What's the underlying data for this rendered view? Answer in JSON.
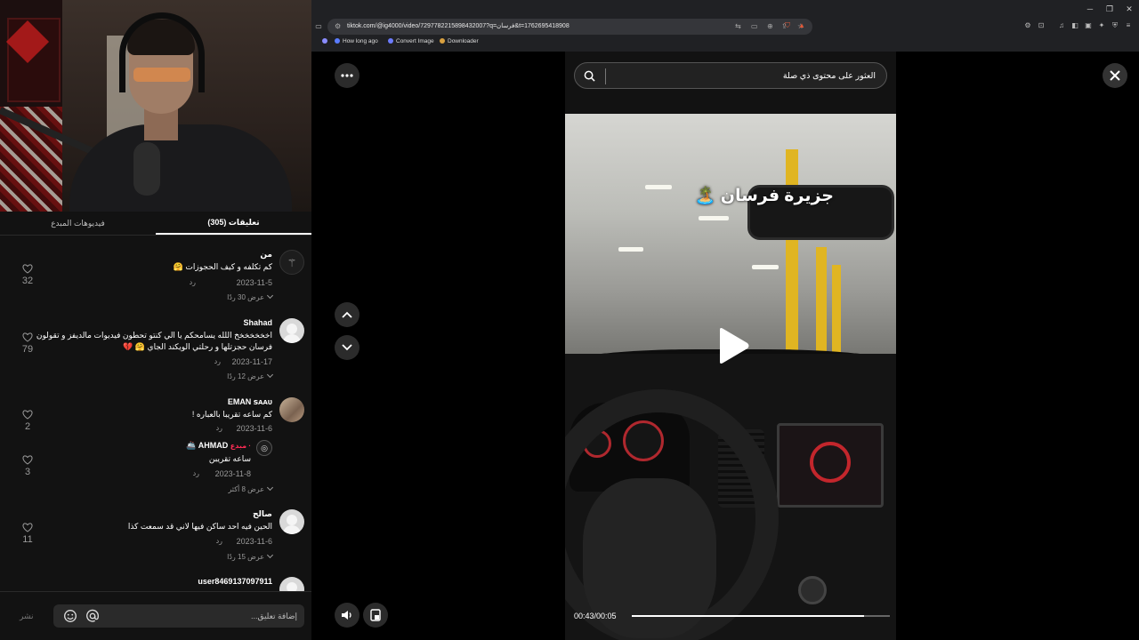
{
  "browser": {
    "url": "tiktok.com/@ig4000/video/7297782215898432007?q=فرسان&t=1762695418908",
    "bookmarks": [
      "How long ago",
      "Convert Image",
      "Downloader"
    ]
  },
  "comments_panel": {
    "tabs": [
      {
        "label": "(305) تعليقات",
        "active": true
      },
      {
        "label": "فيديوهات المبدع",
        "active": false
      }
    ],
    "comments": [
      {
        "name": "من",
        "text": "كم تكلفه و كيف الحجوزات 🤗",
        "date": "2023-11-5",
        "reply": "رد",
        "likes": "32",
        "more": "عرض 30 ردًا"
      },
      {
        "name": "Shahad",
        "text": "اخخخخخخخ اللله يسامحكم يا الي كنتو تحطون فيديوات مالديفز و تقولون فرسان حجزتلها و رحلتي الويكند الجاي 🤗 💔",
        "date": "2023-11-17",
        "reply": "رد",
        "likes": "79",
        "more": "عرض 12 ردًا"
      },
      {
        "name": "EMAN ꜱᴀᴀᴜ",
        "text": "كم ساعه تقريبا بالعباره !",
        "date": "2023-11-6",
        "reply": "رد",
        "likes": "2",
        "more": ""
      },
      {
        "name": "AHMAD 🚢",
        "creator_tag": "· مبدع",
        "text": "ساعه تقريبن",
        "date": "2023-11-8",
        "reply": "رد",
        "likes": "3",
        "more": "عرض 8 أكثر"
      },
      {
        "name": "صالح",
        "text": "الحين فيه احد ساكن فيها لاني قد سمعت كذا",
        "date": "2023-11-6",
        "reply": "رد",
        "likes": "11",
        "more": "عرض 15 ردًا"
      },
      {
        "name": "user8469137097911",
        "text": "",
        "date": "",
        "reply": "",
        "likes": "",
        "more": ""
      }
    ],
    "input": {
      "placeholder": "إضافة تعليق...",
      "post_label": "نشر"
    }
  },
  "viewer": {
    "search_text": "العثور على محتوى ذي صلة",
    "overlay_text": "جزيرة فرسان 🏝️",
    "time": "00:43/00:05",
    "progress": 0.9
  },
  "colors": {
    "creator": "#fe2c55",
    "accent": "#e0b522"
  }
}
